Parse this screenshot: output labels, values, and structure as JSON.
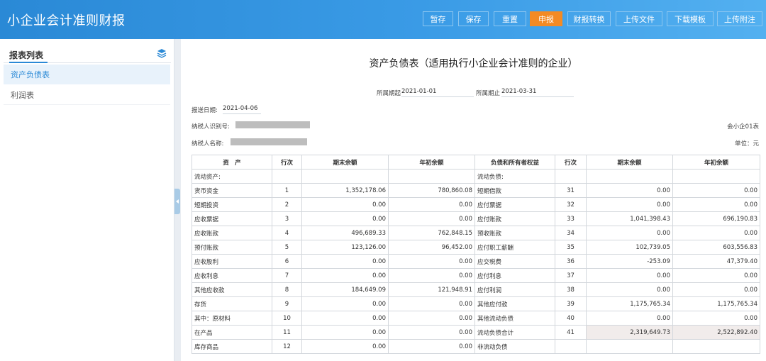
{
  "app": {
    "title": "小企业会计准则财报"
  },
  "toolbar": {
    "buttons": [
      {
        "label": "暂存"
      },
      {
        "label": "保存"
      },
      {
        "label": "重置"
      },
      {
        "label": "申报"
      },
      {
        "label": "财报转换"
      },
      {
        "label": "上传文件"
      },
      {
        "label": "下载模板"
      },
      {
        "label": "上传附注"
      }
    ],
    "accent_color": "#f38a24",
    "brand_color": "#2a89d6"
  },
  "sidebar": {
    "title": "报表列表",
    "icon": "layers-icon",
    "items": [
      {
        "label": "资产负债表",
        "active": true
      },
      {
        "label": "利润表",
        "active": false
      }
    ]
  },
  "report": {
    "title": "资产负债表（适用执行小企业会计准则的企业）",
    "period_start_label": "所属期起",
    "period_start": "2021-01-01",
    "period_end_label": "所属期止",
    "period_end": "2021-03-31",
    "submit_date_label": "报送日期:",
    "submit_date": "2021-04-06",
    "taxpayer_id_label": "纳税人识别号:",
    "taxpayer_name_label": "纳税人名称:",
    "form_code": "会小企01表",
    "unit": "单位：元",
    "headers": [
      "资　产",
      "行次",
      "期末余额",
      "年初余额",
      "负债和所有者权益",
      "行次",
      "期末余额",
      "年初余额"
    ],
    "rows": [
      {
        "a": "流动资产:",
        "al": "",
        "ae": "",
        "ab": "",
        "l": "流动负债:",
        "ll": "",
        "le": "",
        "lb": ""
      },
      {
        "a": "货币资金",
        "al": "1",
        "ae": "1,352,178.06",
        "ab": "780,860.08",
        "l": "短期借款",
        "ll": "31",
        "le": "0.00",
        "lb": "0.00"
      },
      {
        "a": "短期投资",
        "al": "2",
        "ae": "0.00",
        "ab": "0.00",
        "l": "应付票据",
        "ll": "32",
        "le": "0.00",
        "lb": "0.00"
      },
      {
        "a": "应收票据",
        "al": "3",
        "ae": "0.00",
        "ab": "0.00",
        "l": "应付账款",
        "ll": "33",
        "le": "1,041,398.43",
        "lb": "696,190.83"
      },
      {
        "a": "应收账款",
        "al": "4",
        "ae": "496,689.33",
        "ab": "762,848.15",
        "l": "预收账款",
        "ll": "34",
        "le": "0.00",
        "lb": "0.00"
      },
      {
        "a": "预付账款",
        "al": "5",
        "ae": "123,126.00",
        "ab": "96,452.00",
        "l": "应付职工薪酬",
        "ll": "35",
        "le": "102,739.05",
        "lb": "603,556.83"
      },
      {
        "a": "应收股利",
        "al": "6",
        "ae": "0.00",
        "ab": "0.00",
        "l": "应交税费",
        "ll": "36",
        "le": "-253.09",
        "lb": "47,379.40"
      },
      {
        "a": "应收利息",
        "al": "7",
        "ae": "0.00",
        "ab": "0.00",
        "l": "应付利息",
        "ll": "37",
        "le": "0.00",
        "lb": "0.00"
      },
      {
        "a": "其他应收款",
        "al": "8",
        "ae": "184,649.09",
        "ab": "121,948.91",
        "l": "应付利润",
        "ll": "38",
        "le": "0.00",
        "lb": "0.00"
      },
      {
        "a": "存货",
        "al": "9",
        "ae": "0.00",
        "ab": "0.00",
        "l": "其他应付款",
        "ll": "39",
        "le": "1,175,765.34",
        "lb": "1,175,765.34"
      },
      {
        "a": "其中：原材料",
        "al": "10",
        "ae": "0.00",
        "ab": "0.00",
        "l": "其他流动负债",
        "ll": "40",
        "le": "0.00",
        "lb": "0.00"
      },
      {
        "a": "在产品",
        "al": "11",
        "ae": "0.00",
        "ab": "0.00",
        "l": "流动负债合计",
        "ll": "41",
        "le": "2,319,649.73",
        "lb": "2,522,892.40"
      },
      {
        "a": "库存商品",
        "al": "12",
        "ae": "0.00",
        "ab": "0.00",
        "l": "非流动负债",
        "ll": "",
        "le": "",
        "lb": ""
      }
    ]
  }
}
